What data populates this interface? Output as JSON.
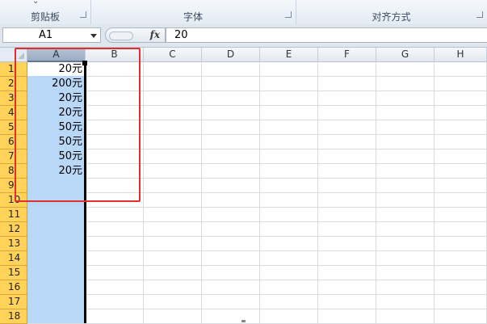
{
  "ribbon": {
    "groups": [
      {
        "label": "剪贴板"
      },
      {
        "label": "字体"
      },
      {
        "label": "对齐方式"
      }
    ]
  },
  "formula_bar": {
    "name_box": "A1",
    "fx_label": "fx",
    "value": "20"
  },
  "sheet": {
    "columns": [
      "A",
      "B",
      "C",
      "D",
      "E",
      "F",
      "G",
      "H"
    ],
    "rows": [
      "1",
      "2",
      "3",
      "4",
      "5",
      "6",
      "7",
      "8",
      "9",
      "10",
      "11",
      "12",
      "13",
      "14",
      "15",
      "16",
      "17",
      "18"
    ],
    "cells_a": [
      "20元",
      "200元",
      "20元",
      "20元",
      "50元",
      "50元",
      "50元",
      "20元"
    ],
    "selected_column": "A",
    "active_cell": "A1"
  },
  "colors": {
    "selection": "#b9d8f7",
    "row_header_selected": "#ffd35a",
    "highlight_box": "#e0302c"
  }
}
